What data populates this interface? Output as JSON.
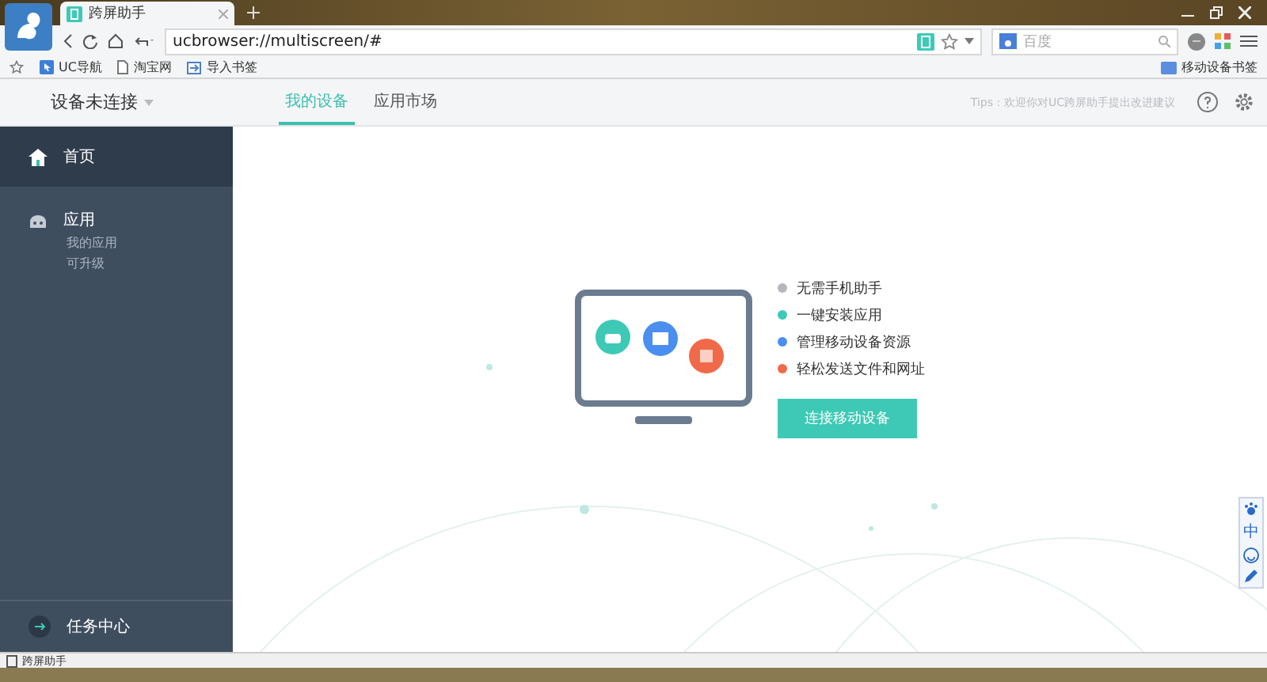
{
  "browser": {
    "tab_title": "跨屏助手",
    "address": "ucbrowser://multiscreen/#",
    "search_placeholder": "百度"
  },
  "bookmarks": [
    {
      "kind": "nav",
      "label": "UC导航"
    },
    {
      "kind": "page",
      "label": "淘宝网"
    },
    {
      "kind": "import",
      "label": "导入书签"
    }
  ],
  "mobile_bookmarks": "移动设备书签",
  "header": {
    "device_status": "设备未连接",
    "tabs": [
      {
        "label": "我的设备",
        "selected": true
      },
      {
        "label": "应用市场",
        "selected": false
      }
    ],
    "tips": "Tips：欢迎你对UC跨屏助手提出改进建议"
  },
  "sidebar": {
    "items": [
      {
        "kind": "home",
        "label": "首页",
        "selected": true
      },
      {
        "kind": "apps",
        "label": "应用",
        "selected": false,
        "children": [
          {
            "label": "我的应用"
          },
          {
            "label": "可升级"
          }
        ]
      }
    ],
    "footer": "任务中心"
  },
  "features": [
    {
      "label": "无需手机助手",
      "color": "#b4b8bd"
    },
    {
      "label": "一键安装应用",
      "color": "#3ec9b6"
    },
    {
      "label": "管理移动设备资源",
      "color": "#4a8ff0"
    },
    {
      "label": "轻松发送文件和网址",
      "color": "#f06a4a"
    }
  ],
  "connect_button": "连接移动设备",
  "ime_toolbar": {
    "mode": "中"
  },
  "status_bar": "跨屏助手"
}
